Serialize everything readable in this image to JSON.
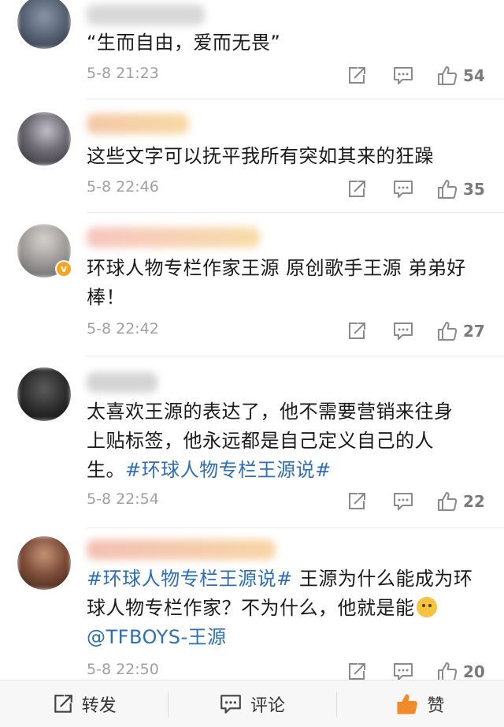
{
  "comments": [
    {
      "text": "“生而自由，爱而无畏”",
      "time": "5-8 21:23",
      "likes": "54"
    },
    {
      "text": "这些文字可以抚平我所有突如其来的狂躁",
      "time": "5-8 22:46",
      "likes": "35"
    },
    {
      "text_line1": "环球人物专栏作家王源 原创歌手王源 弟弟好",
      "text_line2": "棒！",
      "time": "5-8 22:42",
      "likes": "27",
      "verified": "v"
    },
    {
      "text_line1": "太喜欢王源的表达了，他不需要营销来往身",
      "text_line2": "上贴标签，他永远都是自己定义自己的人",
      "text_line3_plain": "生。",
      "text_line3_tag": "#环球人物专栏王源说#",
      "time": "5-8 22:54",
      "likes": "22"
    },
    {
      "text_line1_tag": "#环球人物专栏王源说#",
      "text_line1_plain": " 王源为什么能成为环",
      "text_line2": "球人物专栏作家？不为什么，他就是能",
      "text_line3_mention": "@TFBOYS-王源",
      "time": "5-8 22:50",
      "likes": "20"
    }
  ],
  "bottom_bar": {
    "repost": "转发",
    "comment": "评论",
    "like": "赞"
  },
  "colors": {
    "link": "#2e6eb5",
    "like_active": "#f08b2c",
    "meta": "#a0a0a0"
  },
  "icons": [
    "share-icon",
    "comment-icon",
    "thumbs-up-icon"
  ]
}
